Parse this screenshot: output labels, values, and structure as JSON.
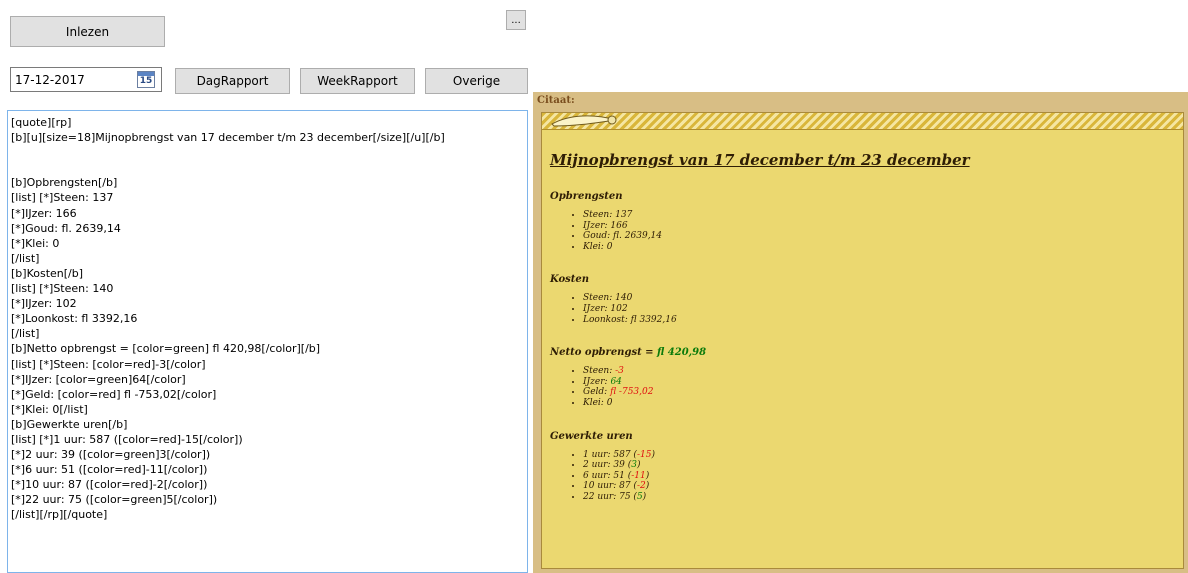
{
  "toolbar": {
    "read_label": "Inlezen",
    "browse_label": "...",
    "date_value": "17-12-2017",
    "calendar_day": "15",
    "day_report_label": "DagRapport",
    "week_report_label": "WeekRapport",
    "other_label": "Overige"
  },
  "editor": {
    "text": "[quote][rp]\n[b][u][size=18]Mijnopbrengst van 17 december t/m 23 december[/size][/u][/b]\n\n\n[b]Opbrengsten[/b]\n[list] [*]Steen: 137\n[*]IJzer: 166\n[*]Goud: fl. 2639,14\n[*]Klei: 0\n[/list]\n[b]Kosten[/b]\n[list] [*]Steen: 140\n[*]IJzer: 102\n[*]Loonkost: fl 3392,16\n[/list]\n[b]Netto opbrengst = [color=green] fl 420,98[/color][/b]\n[list] [*]Steen: [color=red]-3[/color]\n[*]IJzer: [color=green]64[/color]\n[*]Geld: [color=red] fl -753,02[/color]\n[*]Klei: 0[/list]\n[b]Gewerkte uren[/b]\n[list] [*]1 uur: 587 ([color=red]-15[/color])\n[*]2 uur: 39 ([color=green]3[/color])\n[*]6 uur: 51 ([color=red]-11[/color])\n[*]10 uur: 87 ([color=red]-2[/color])\n[*]22 uur: 75 ([color=green]5[/color])\n[/list][/rp][/quote]"
  },
  "preview": {
    "label": "Citaat:",
    "title": "Mijnopbrengst van 17 december t/m 23 december",
    "income": {
      "heading": "Opbrengsten",
      "items": [
        "Steen: 137",
        "IJzer: 166",
        "Goud: fl. 2639,14",
        "Klei: 0"
      ]
    },
    "costs": {
      "heading": "Kosten",
      "items": [
        "Steen: 140",
        "IJzer: 102",
        "Loonkost: fl 3392,16"
      ]
    },
    "net": {
      "heading": "Netto opbrengst = ",
      "value": "fl 420,98",
      "items": [
        {
          "label": "Steen: ",
          "value": "-3",
          "tone": "red"
        },
        {
          "label": "IJzer: ",
          "value": "64",
          "tone": "green"
        },
        {
          "label": "Geld: ",
          "value": "fl -753,02",
          "tone": "red"
        },
        {
          "label": "Klei: ",
          "value": "0",
          "tone": "none"
        }
      ]
    },
    "hours": {
      "heading": "Gewerkte uren",
      "items": [
        {
          "label": "1 uur: 587 (",
          "value": "-15",
          "tone": "red",
          "suffix": ")"
        },
        {
          "label": "2 uur: 39 (",
          "value": "3",
          "tone": "green",
          "suffix": ")"
        },
        {
          "label": "6 uur: 51 (",
          "value": "-11",
          "tone": "red",
          "suffix": ")"
        },
        {
          "label": "10 uur: 87 (",
          "value": "-2",
          "tone": "red",
          "suffix": ")"
        },
        {
          "label": "22 uur: 75 (",
          "value": "5",
          "tone": "green",
          "suffix": ")"
        }
      ]
    }
  },
  "colors": {
    "positive": "#0a7a0a",
    "negative": "#e01010",
    "quote_background": "#ebd870"
  }
}
